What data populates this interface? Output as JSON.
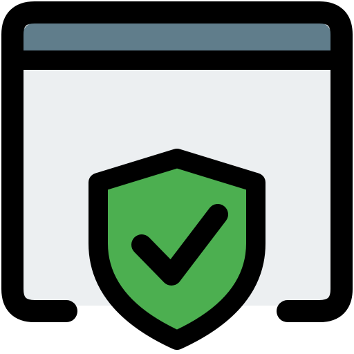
{
  "icon": {
    "name": "secure-browser-window-icon",
    "parts": [
      "browser-window-icon",
      "shield-icon",
      "checkmark-icon"
    ]
  },
  "colors": {
    "outline": "#000000",
    "title_bar": "#607d8b",
    "window_body": "#eceff1",
    "shield_fill": "#4caf50",
    "background": "#ffffff"
  }
}
